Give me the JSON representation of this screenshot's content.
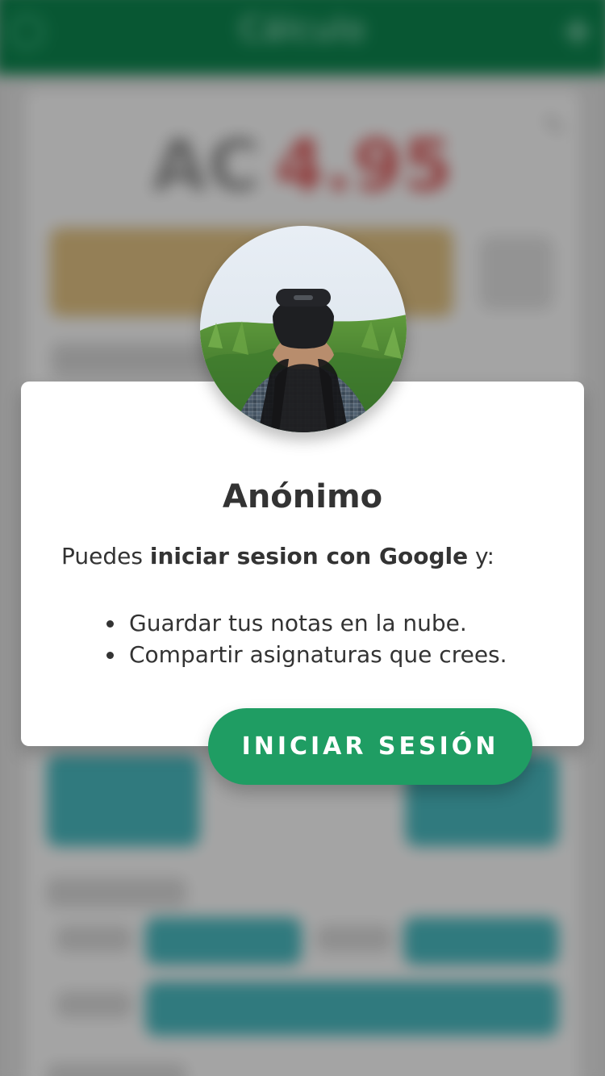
{
  "background": {
    "topbar": {
      "title": "Cálculo",
      "menu_icon": "menu-icon",
      "add_icon": "plus-icon"
    },
    "score": {
      "label": "AC",
      "value": "4.95"
    }
  },
  "dialog": {
    "title": "Anónimo",
    "intro_prefix": "Puedes ",
    "intro_bold": "iniciar sesion con Google",
    "intro_suffix": " y:",
    "bullets": [
      "Guardar tus notas en la nube.",
      "Compartir asignaturas que crees."
    ],
    "button_label": "INICIAR SESIÓN"
  },
  "colors": {
    "topbar_green": "#0a6b3f",
    "button_green": "#1f9d63",
    "score_red": "#b04a4a",
    "gold": "#b49a64",
    "teal": "#2b8f95"
  }
}
